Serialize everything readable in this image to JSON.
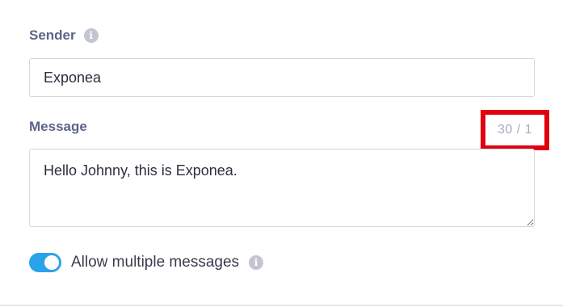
{
  "sender": {
    "label": "Sender",
    "info_icon": "info-icon",
    "value": "Exponea"
  },
  "message": {
    "label": "Message",
    "counter": "30 / 1",
    "value": "Hello Johnny, this is Exponea."
  },
  "allow_multiple": {
    "label": "Allow multiple messages",
    "enabled": true,
    "info_icon": "info-icon"
  },
  "colors": {
    "label": "#5f6388",
    "toggle_on": "#2ba3e8",
    "highlight": "#e1000f",
    "counter": "#a9abbe"
  }
}
